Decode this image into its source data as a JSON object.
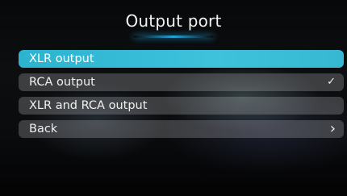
{
  "header": {
    "title": "Output port"
  },
  "menu": {
    "items": [
      {
        "label": "XLR output",
        "indicator": ""
      },
      {
        "label": "RCA output",
        "indicator": "✓",
        "indicator_icon": "checkmark-icon"
      },
      {
        "label": "XLR and RCA output",
        "indicator": ""
      },
      {
        "label": "Back",
        "indicator": "›",
        "indicator_icon": "chevron-right-icon"
      }
    ],
    "highlighted_index": 0,
    "checked_index": 1
  },
  "colors": {
    "highlight": "#3ec2dc",
    "title_glow": "#28b4f0",
    "item_background": "#8f8f95"
  }
}
